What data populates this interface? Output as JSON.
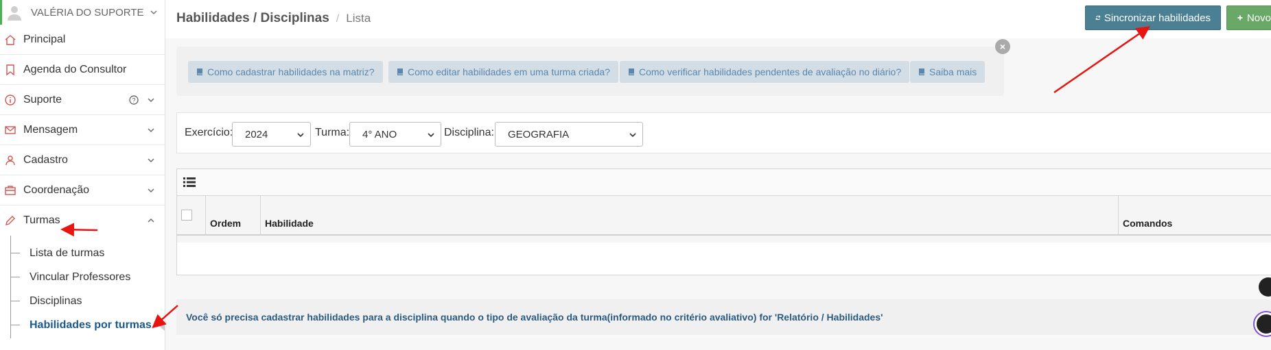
{
  "user": {
    "name": "VALÉRIA DO SUPORTE"
  },
  "sidebar": {
    "items": [
      {
        "label": "Principal"
      },
      {
        "label": "Agenda do Consultor"
      },
      {
        "label": "Suporte"
      },
      {
        "label": "Mensagem"
      },
      {
        "label": "Cadastro"
      },
      {
        "label": "Coordenação"
      },
      {
        "label": "Turmas"
      }
    ],
    "submenu": [
      {
        "label": "Lista de turmas"
      },
      {
        "label": "Vincular Professores"
      },
      {
        "label": "Disciplinas"
      },
      {
        "label": "Habilidades por turmas"
      }
    ]
  },
  "header": {
    "title": "Habilidades / Disciplinas",
    "separator": "/",
    "crumb": "Lista",
    "sync_label": "Sincronizar habilidades",
    "new_label": "Novo"
  },
  "help": {
    "close": "×",
    "links": [
      {
        "label": "Como cadastrar habilidades na matriz?"
      },
      {
        "label": "Como editar habilidades em uma turma criada?"
      },
      {
        "label": "Como verificar habilidades pendentes de avaliação no diário?"
      },
      {
        "label": "Saiba mais"
      }
    ]
  },
  "filters": {
    "exercicio_label": "Exercício:",
    "exercicio_value": "2024",
    "turma_label": "Turma:",
    "turma_value": "4° ANO",
    "disciplina_label": "Disciplina:",
    "disciplina_value": "GEOGRAFIA"
  },
  "table": {
    "columns": [
      "Ordem",
      "Habilidade",
      "Comandos"
    ]
  },
  "info": {
    "text": "Você só precisa cadastrar habilidades para a disciplina quando o tipo de avaliação da turma(informado no critério avaliativo) for 'Relatório / Habilidades'"
  },
  "colors": {
    "sync_button": "#4a7f94",
    "new_button": "#69a866",
    "active_submenu": "#1a5a8a",
    "menu_icons": "#d9534f",
    "annotation_arrows": "#e8140f"
  },
  "icons": {
    "avatar": "user-avatar-icon",
    "principal": "home-icon",
    "agenda": "bookmark-icon",
    "suporte": "info-icon",
    "mensagem": "envelope-icon",
    "cadastro": "person-icon",
    "coordenacao": "briefcase-icon",
    "turmas": "pencil-icon",
    "sync": "refresh-icon",
    "new": "plus-icon",
    "help_link": "book-icon",
    "grid_toolbar": "list-icon"
  }
}
